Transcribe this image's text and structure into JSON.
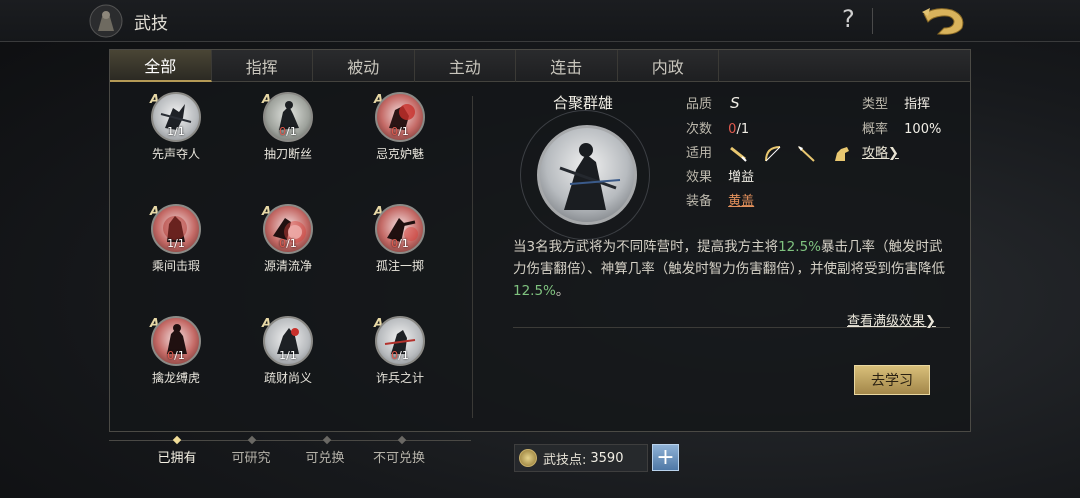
{
  "header": {
    "title": "武技",
    "help_icon": "question-mark-icon",
    "back_icon": "dragon-back-icon"
  },
  "tabs": [
    {
      "label": "全部",
      "active": true
    },
    {
      "label": "指挥",
      "active": false
    },
    {
      "label": "被动",
      "active": false
    },
    {
      "label": "主动",
      "active": false
    },
    {
      "label": "连击",
      "active": false
    },
    {
      "label": "内政",
      "active": false
    }
  ],
  "skills": [
    {
      "name": "先声夺人",
      "grade": "A",
      "owned": "1",
      "total": "/1",
      "style": "white"
    },
    {
      "name": "抽刀断丝",
      "grade": "A",
      "owned": "0",
      "total": "/1",
      "style": "pale"
    },
    {
      "name": "忌克妒魅",
      "grade": "A",
      "owned": "0",
      "total": "/1",
      "style": "red"
    },
    {
      "name": "乘间击瑕",
      "grade": "A",
      "owned": "1",
      "total": "/1",
      "style": "red"
    },
    {
      "name": "源清流净",
      "grade": "A",
      "owned": "0",
      "total": "/1",
      "style": "red"
    },
    {
      "name": "孤注一掷",
      "grade": "A",
      "owned": "0",
      "total": "/1",
      "style": "red"
    },
    {
      "name": "擒龙缚虎",
      "grade": "A",
      "owned": "0",
      "total": "/1",
      "style": "red"
    },
    {
      "name": "疏财尚义",
      "grade": "A",
      "owned": "1",
      "total": "/1",
      "style": "white"
    },
    {
      "name": "诈兵之计",
      "grade": "A",
      "owned": "0",
      "total": "/1",
      "style": "white"
    }
  ],
  "detail": {
    "name": "合聚群雄",
    "quality_label": "品质",
    "quality_value": "S",
    "count_label": "次数",
    "count_owned": "0",
    "count_total": "/1",
    "apply_label": "适用",
    "weapons": [
      "sword-icon",
      "bow-icon",
      "spear-icon",
      "horse-icon"
    ],
    "effect_label": "效果",
    "effect_value": "增益",
    "equip_label": "装备",
    "equip_value": "黄盖",
    "type_label": "类型",
    "type_value": "指挥",
    "rate_label": "概率",
    "rate_value": "100%",
    "guide_link": "攻略❯",
    "desc_1": "当3名我方武将为不同阵营时，提高我方主将",
    "desc_hl_1": "12.5%",
    "desc_2": "暴击几率（触发时武力伤害翻倍）、神算几率（触发时智力伤害翻倍），并使副将受到伤害降低",
    "desc_hl_2": "12.5%",
    "desc_3": "。",
    "full_effect_link": "查看满级效果❯",
    "learn_button": "去学习"
  },
  "filters": [
    {
      "label": "已拥有",
      "active": true
    },
    {
      "label": "可研究",
      "active": false
    },
    {
      "label": "可兑换",
      "active": false
    },
    {
      "label": "不可兑换",
      "active": false
    }
  ],
  "points": {
    "label": "武技点:",
    "value": "3590",
    "plus": "+"
  }
}
